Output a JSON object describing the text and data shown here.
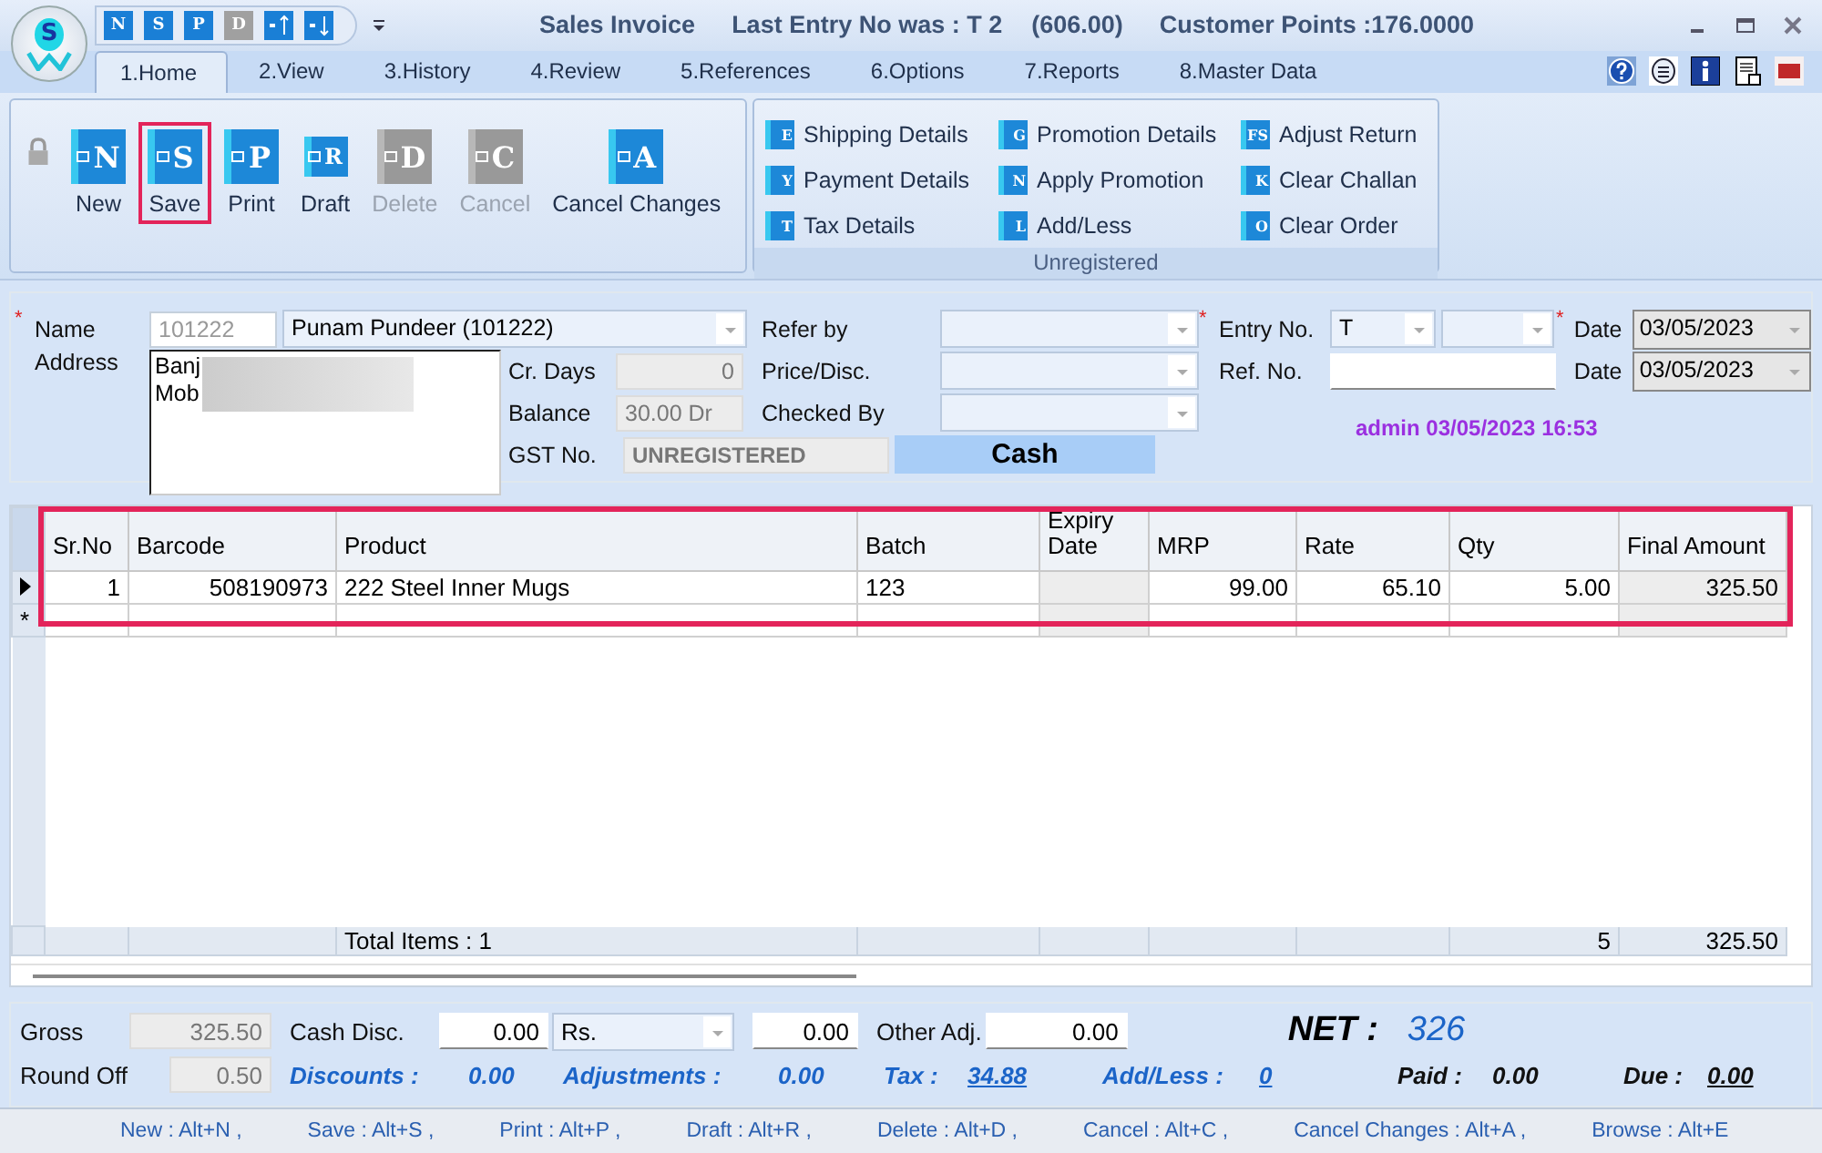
{
  "window": {
    "logo_letter": "S",
    "title": "Sales Invoice",
    "last_entry": "Last Entry No was : T 2",
    "amount": "(606.00)",
    "points": "Customer Points :176.0000"
  },
  "quick_access": [
    {
      "kind": "letter",
      "letter": "N",
      "disabled": false
    },
    {
      "kind": "letter",
      "letter": "S",
      "disabled": false
    },
    {
      "kind": "letter",
      "letter": "P",
      "disabled": false
    },
    {
      "kind": "letter",
      "letter": "D",
      "disabled": true
    },
    {
      "kind": "up",
      "disabled": false
    },
    {
      "kind": "down",
      "disabled": false
    }
  ],
  "tabs": [
    {
      "label": "1.Home",
      "selected": true
    },
    {
      "label": "2.View",
      "selected": false
    },
    {
      "label": "3.History",
      "selected": false
    },
    {
      "label": "4.Review",
      "selected": false
    },
    {
      "label": "5.References",
      "selected": false
    },
    {
      "label": "6.Options",
      "selected": false
    },
    {
      "label": "7.Reports",
      "selected": false
    },
    {
      "label": "8.Master Data",
      "selected": false
    }
  ],
  "ribbon": {
    "buttons": [
      {
        "label": "New",
        "letter": "N",
        "disabled": false,
        "highlighted": false
      },
      {
        "label": "Save",
        "letter": "S",
        "disabled": false,
        "highlighted": true
      },
      {
        "label": "Print",
        "letter": "P",
        "disabled": false,
        "highlighted": false
      },
      {
        "label": "Draft",
        "letter": "R",
        "disabled": false,
        "highlighted": false
      },
      {
        "label": "Delete",
        "letter": "D",
        "disabled": true,
        "highlighted": false
      },
      {
        "label": "Cancel",
        "letter": "C",
        "disabled": true,
        "highlighted": false
      },
      {
        "label": "Cancel Changes",
        "letter": "A",
        "disabled": false,
        "highlighted": false
      }
    ],
    "links": [
      {
        "label": "Shipping Details",
        "letter": "E"
      },
      {
        "label": "Payment Details",
        "letter": "Y"
      },
      {
        "label": "Tax Details",
        "letter": "T"
      },
      {
        "label": "Promotion Details",
        "letter": "G"
      },
      {
        "label": "Apply Promotion",
        "letter": "N"
      },
      {
        "label": "Add/Less",
        "letter": "L"
      },
      {
        "label": "Adjust Return",
        "letter": "FS"
      },
      {
        "label": "Clear Challan",
        "letter": "K"
      },
      {
        "label": "Clear Order",
        "letter": "O"
      }
    ],
    "group_label": "Unregistered"
  },
  "form": {
    "name_label": "Name",
    "name_code": "101222",
    "name_value": "Punam Pundeer (101222)",
    "address_label": "Address",
    "address_lines": [
      "Banj",
      "Mob"
    ],
    "cr_days_label": "Cr. Days",
    "cr_days": "0",
    "balance_label": "Balance",
    "balance": "30.00 Dr",
    "gst_label": "GST No.",
    "gst": "UNREGISTERED",
    "refer_by_label": "Refer by",
    "price_disc_label": "Price/Disc.",
    "checked_by_label": "Checked By",
    "payment_mode": "Cash",
    "entry_no_label": "Entry No.",
    "entry_prefix": "T",
    "ref_no_label": "Ref. No.",
    "date_label": "Date",
    "date": "03/05/2023",
    "date2_label": "Date",
    "date2": "03/05/2023",
    "user_stamp": "admin 03/05/2023 16:53"
  },
  "grid": {
    "highlighted": true,
    "columns": [
      "Sr.No",
      "Barcode",
      "Product",
      "Batch",
      "Expiry Date",
      "MRP",
      "Rate",
      "Qty",
      "Final Amount"
    ],
    "rows": [
      [
        "1",
        "508190973",
        "222 Steel Inner Mugs",
        "123",
        "",
        "99.00",
        "65.10",
        "5.00",
        "325.50"
      ]
    ],
    "new_row_marker": "*",
    "totals": {
      "items": "Total Items : 1",
      "qty": "5",
      "amount": "325.50"
    }
  },
  "summary": {
    "gross_label": "Gross",
    "gross": "325.50",
    "cash_disc_label": "Cash Disc.",
    "cash_disc": "0.00",
    "disc_unit": "Rs.",
    "disc_value": "0.00",
    "other_adj_label": "Other Adj.",
    "other_adj": "0.00",
    "round_off_label": "Round Off",
    "round_off": "0.50",
    "discounts_label": "Discounts :",
    "discounts": "0.00",
    "adjustments_label": "Adjustments :",
    "adjustments": "0.00",
    "tax_label": "Tax :",
    "tax": "34.88",
    "add_less_label": "Add/Less :",
    "add_less": "0",
    "net_label": "NET :",
    "net": "326",
    "paid_label": "Paid :",
    "paid": "0.00",
    "due_label": "Due :",
    "due": "0.00"
  },
  "shortcuts": [
    "New : Alt+N ,",
    "Save : Alt+S ,",
    "Print : Alt+P ,",
    "Draft : Alt+R ,",
    "Delete : Alt+D ,",
    "Cancel : Alt+C ,",
    "Cancel Changes : Alt+A ,",
    "Browse : Alt+E"
  ]
}
